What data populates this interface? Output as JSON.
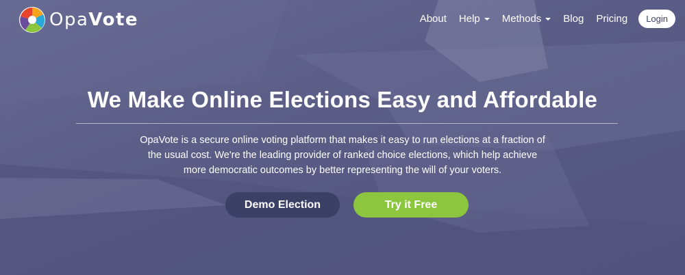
{
  "logo": {
    "text_prefix": "Opa",
    "text_suffix": "Vote"
  },
  "nav": {
    "items": [
      {
        "label": "About"
      },
      {
        "label": "Help"
      },
      {
        "label": "Methods"
      },
      {
        "label": "Blog"
      },
      {
        "label": "Pricing"
      }
    ],
    "login_label": "Login"
  },
  "hero": {
    "headline": "We Make Online Elections Easy and Affordable",
    "tagline": "OpaVote is a secure online voting platform that makes it easy to run elections at a fraction of the usual cost. We're the leading provider of ranked choice elections, which help achieve more democratic outcomes by better representing the will of your voters.",
    "demo_button": "Demo Election",
    "try_button": "Try it Free"
  },
  "colors": {
    "overlay": "#5f6189",
    "demo_button": "#3b4066",
    "try_button": "#8cc63f",
    "logo_slices": [
      "#e8432c",
      "#f7a21b",
      "#8cc63f",
      "#2aa8d8",
      "#6a4c9c"
    ]
  }
}
